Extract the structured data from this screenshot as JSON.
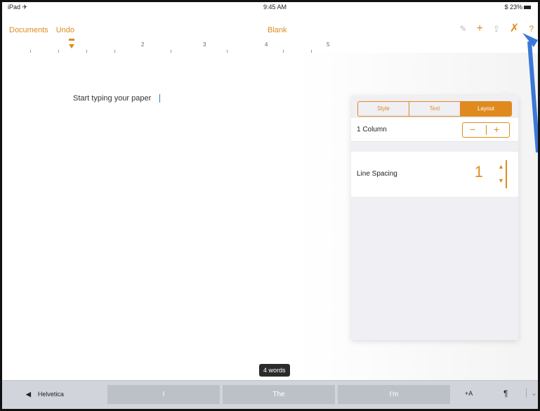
{
  "status": {
    "left": "iPad ✈",
    "time": "9:45 AM",
    "battery": "$ 23%"
  },
  "toolbar": {
    "documents_label": "Documents",
    "undo_label": "Undo",
    "title": "Blank",
    "icons": [
      "brush-icon",
      "plus-icon",
      "share-icon",
      "wrench-icon",
      "help-icon"
    ]
  },
  "ruler": {
    "numbers": [
      "2",
      "3",
      "4",
      "5"
    ]
  },
  "document": {
    "placeholder": "Start typing your paper"
  },
  "popover": {
    "segments": [
      "Style",
      "Text",
      "Layout"
    ],
    "columns_label": "1 Column",
    "stepper_minus": "−",
    "stepper_plus": "+",
    "line_spacing_label": "Line Spacing",
    "line_spacing_value": "1",
    "spin_up": "▲",
    "spin_down": "▼"
  },
  "word_count": "4 words",
  "keyboard": {
    "font_label": "Helvetica",
    "font_icon": "◀",
    "suggestions": [
      "I",
      "The",
      "I'm"
    ],
    "aa_label": "+A",
    "paragraph_label": "¶",
    "hide_label": "⌄"
  },
  "colors": {
    "accent": "#e08a1e",
    "arrow": "#3a78d8"
  }
}
